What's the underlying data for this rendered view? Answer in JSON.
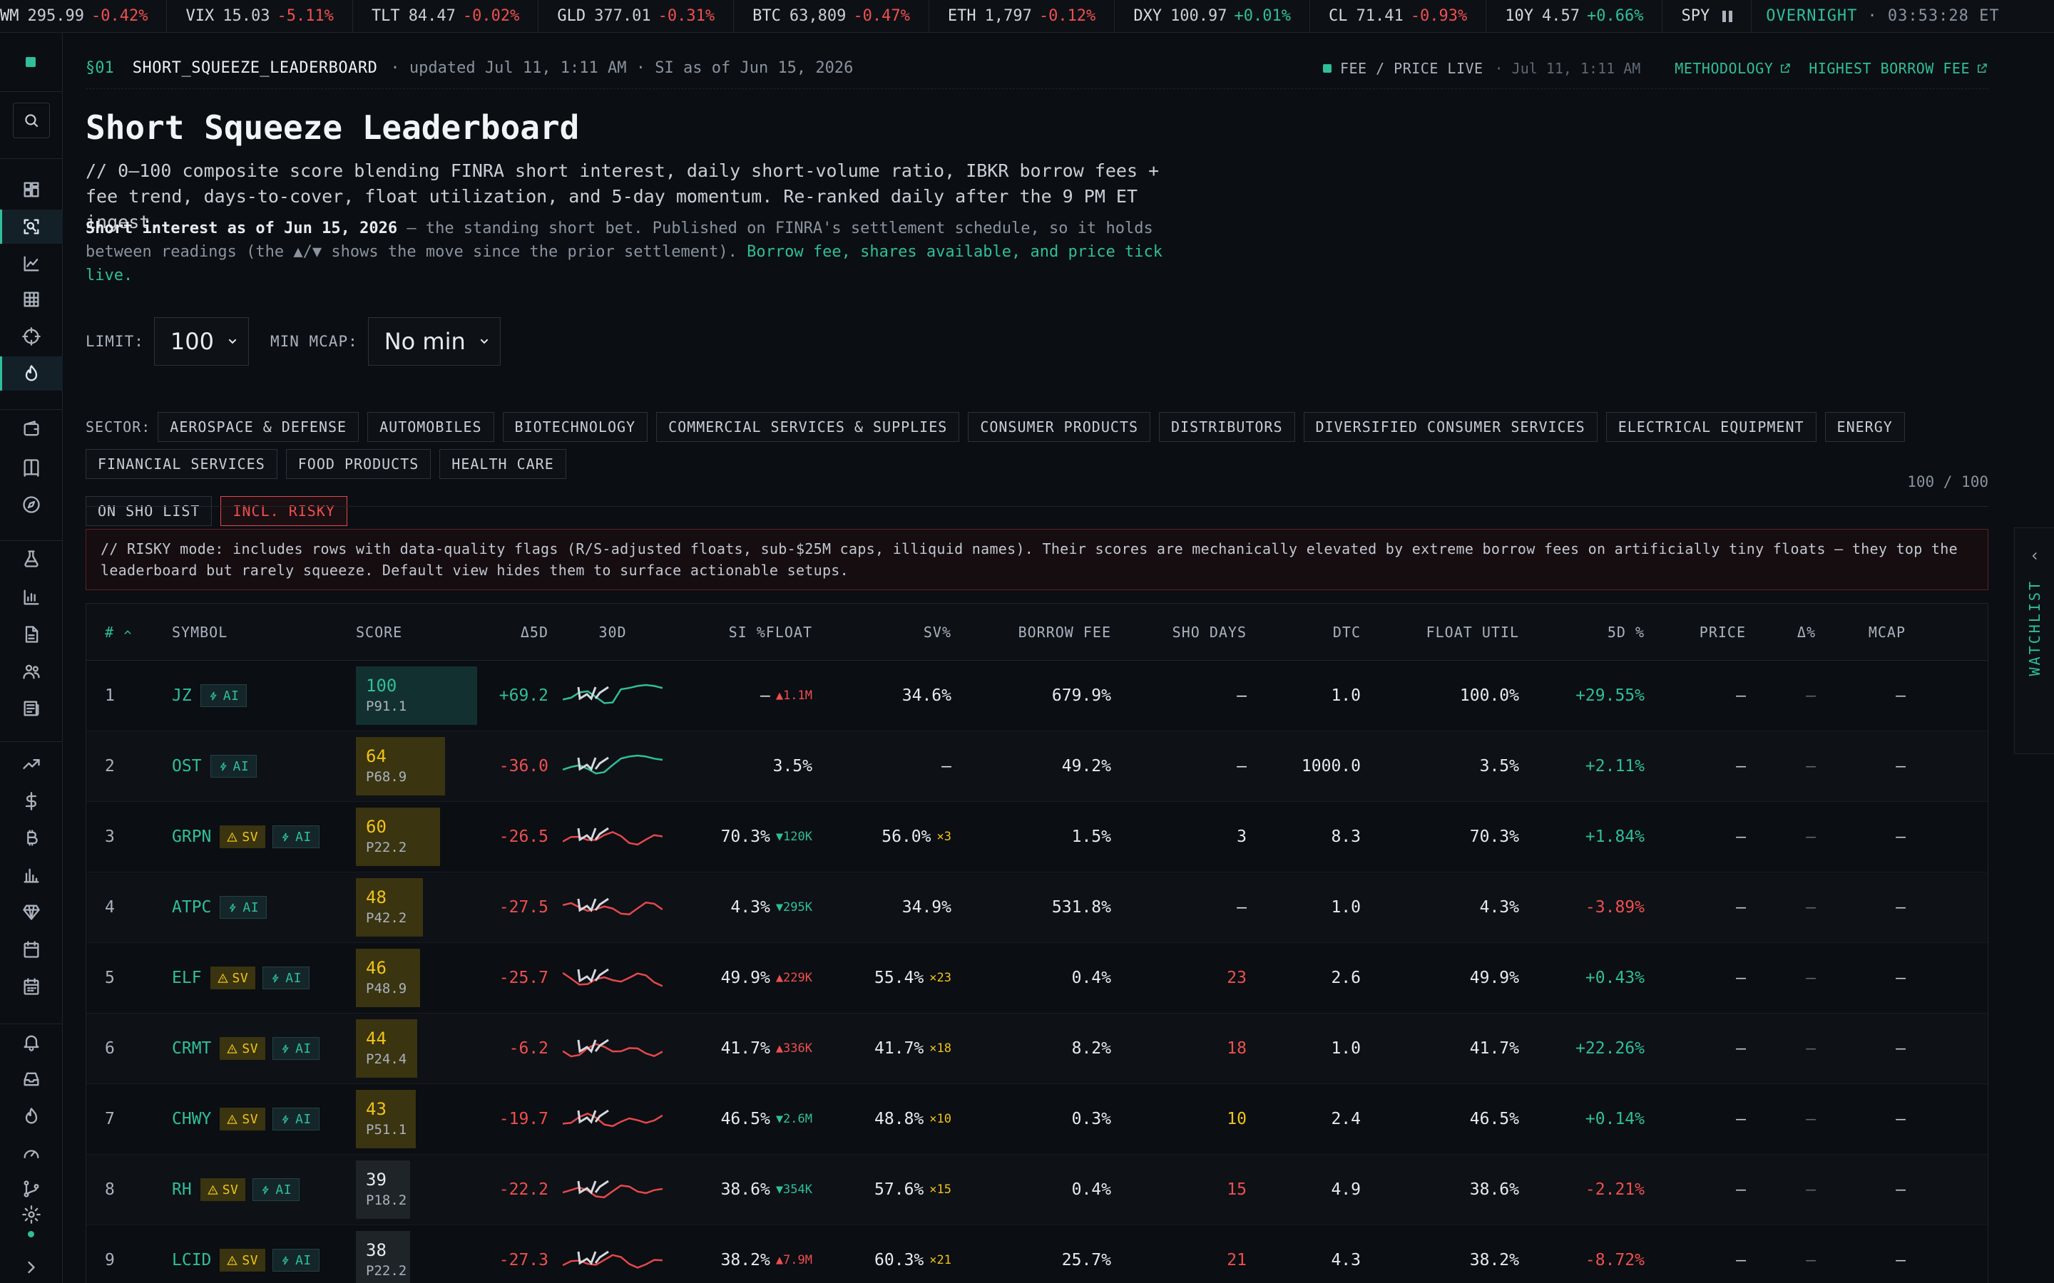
{
  "ticker": {
    "items": [
      {
        "sym": "WM",
        "price": "295.99",
        "chg": "-0.42%",
        "dir": "neg"
      },
      {
        "sym": "VIX",
        "price": "15.03",
        "chg": "-5.11%",
        "dir": "neg"
      },
      {
        "sym": "TLT",
        "price": "84.47",
        "chg": "-0.02%",
        "dir": "neg"
      },
      {
        "sym": "GLD",
        "price": "377.01",
        "chg": "-0.31%",
        "dir": "neg"
      },
      {
        "sym": "BTC",
        "price": "63,809",
        "chg": "-0.47%",
        "dir": "neg"
      },
      {
        "sym": "ETH",
        "price": "1,797",
        "chg": "-0.12%",
        "dir": "neg"
      },
      {
        "sym": "DXY",
        "price": "100.97",
        "chg": "+0.01%",
        "dir": "pos"
      },
      {
        "sym": "CL",
        "price": "71.41",
        "chg": "-0.93%",
        "dir": "neg"
      },
      {
        "sym": "10Y",
        "price": "4.57",
        "chg": "+0.66%",
        "dir": "pos"
      }
    ],
    "paused_sym": "SPY",
    "session": "OVERNIGHT",
    "clock": "· 03:53:28 ET"
  },
  "rail": {
    "icons": [
      "dashboard-icon",
      "screener-icon",
      "chart-line-icon",
      "grid-icon",
      "crosshair-icon",
      "flame-icon",
      "wallet-icon",
      "book-icon",
      "compass-icon",
      "flask-icon",
      "bar-chart-icon",
      "document-icon",
      "users-icon",
      "newspaper-icon",
      "trending-icon",
      "dollar-icon",
      "bitcoin-icon",
      "column-chart-icon",
      "gem-icon",
      "calendar-icon",
      "calendar-grid-icon",
      "bell-icon",
      "inbox-icon",
      "fire-icon",
      "gauge-icon",
      "git-branch-icon",
      "settings-icon"
    ]
  },
  "header": {
    "section": "§01",
    "key": "SHORT_SQUEEZE_LEADERBOARD",
    "meta": "· updated Jul 11, 1:11 AM · SI as of Jun 15, 2026",
    "live_label": "FEE / PRICE LIVE",
    "live_time": "· Jul 11, 1:11 AM",
    "methodology": "METHODOLOGY",
    "highest_fee": "HIGHEST BORROW FEE"
  },
  "page": {
    "title": "Short Squeeze Leaderboard",
    "lede": "// 0–100 composite score blending FINRA short interest, daily short-volume ratio, IBKR borrow fees + fee trend, days-to-cover, float utilization, and 5-day momentum. Re-ranked daily after the 9 PM ET ingest.",
    "asof_bold": "Short interest as of Jun 15, 2026",
    "asof_text": " — the standing short bet. Published on FINRA's settlement schedule, so it holds between readings (the ▲/▼ shows the move since the prior settlement). ",
    "asof_live": "Borrow fee, shares available, and price tick live."
  },
  "filters": {
    "limit_label": "LIMIT:",
    "limit_value": "100",
    "mcap_label": "MIN MCAP:",
    "mcap_value": "No min",
    "sector_label": "SECTOR:",
    "sectors": [
      "AEROSPACE & DEFENSE",
      "AUTOMOBILES",
      "BIOTECHNOLOGY",
      "COMMERCIAL SERVICES & SUPPLIES",
      "CONSUMER PRODUCTS",
      "DISTRIBUTORS",
      "DIVERSIFIED CONSUMER SERVICES",
      "ELECTRICAL EQUIPMENT",
      "ENERGY",
      "FINANCIAL SERVICES",
      "FOOD PRODUCTS",
      "HEALTH CARE"
    ],
    "sho_list": "ON SHO LIST",
    "risky": "INCL. RISKY",
    "count": "100 / 100"
  },
  "warning": "// RISKY mode: includes rows with data-quality flags (R/S-adjusted floats, sub-$25M caps, illiquid names). Their scores are mechanically elevated by extreme borrow fees on artificially tiny floats — they top the leaderboard but rarely squeeze. Default view hides them to surface actionable setups.",
  "table": {
    "columns": [
      "#",
      "SYMBOL",
      "SCORE",
      "Δ5D",
      "30D",
      "SI %FLOAT",
      "SV%",
      "BORROW FEE",
      "SHO DAYS",
      "DTC",
      "FLOAT UTIL",
      "5D %",
      "PRICE",
      "Δ%",
      "MCAP"
    ],
    "rows": [
      {
        "rank": "1",
        "sym": "JZ",
        "sv": false,
        "score": "100",
        "pctile": "P91.1",
        "tier": "teal",
        "d5": "+69.2",
        "d5dir": "pos",
        "trend": "up",
        "si": "—",
        "si_chg": "▲1.1M",
        "si_dir": "up",
        "sv_pct": "34.6%",
        "sv_mult": "",
        "fee": "679.9%",
        "sho": "—",
        "sho_tier": "none",
        "dtc": "1.0",
        "util": "100.0%",
        "r5d": "+29.55%",
        "r5d_dir": "pos",
        "price": "—",
        "dp": "—",
        "mcap": "—"
      },
      {
        "rank": "2",
        "sym": "OST",
        "sv": false,
        "score": "64",
        "pctile": "P68.9",
        "tier": "amber",
        "d5": "-36.0",
        "d5dir": "neg",
        "trend": "up",
        "si": "3.5%",
        "si_chg": "",
        "si_dir": "",
        "sv_pct": "—",
        "sv_mult": "",
        "fee": "49.2%",
        "sho": "—",
        "sho_tier": "none",
        "dtc": "1000.0",
        "util": "3.5%",
        "r5d": "+2.11%",
        "r5d_dir": "pos",
        "price": "—",
        "dp": "—",
        "mcap": "—"
      },
      {
        "rank": "3",
        "sym": "GRPN",
        "sv": true,
        "score": "60",
        "pctile": "P22.2",
        "tier": "amber",
        "d5": "-26.5",
        "d5dir": "neg",
        "trend": "down",
        "si": "70.3%",
        "si_chg": "▼120K",
        "si_dir": "down",
        "sv_pct": "56.0%",
        "sv_mult": "×3",
        "fee": "1.5%",
        "sho": "3",
        "sho_tier": "plain",
        "dtc": "8.3",
        "util": "70.3%",
        "r5d": "+1.84%",
        "r5d_dir": "pos",
        "price": "—",
        "dp": "—",
        "mcap": "—"
      },
      {
        "rank": "4",
        "sym": "ATPC",
        "sv": false,
        "score": "48",
        "pctile": "P42.2",
        "tier": "amber",
        "d5": "-27.5",
        "d5dir": "neg",
        "trend": "down",
        "si": "4.3%",
        "si_chg": "▼295K",
        "si_dir": "down",
        "sv_pct": "34.9%",
        "sv_mult": "",
        "fee": "531.8%",
        "sho": "—",
        "sho_tier": "none",
        "dtc": "1.0",
        "util": "4.3%",
        "r5d": "-3.89%",
        "r5d_dir": "neg",
        "price": "—",
        "dp": "—",
        "mcap": "—"
      },
      {
        "rank": "5",
        "sym": "ELF",
        "sv": true,
        "score": "46",
        "pctile": "P48.9",
        "tier": "amber",
        "d5": "-25.7",
        "d5dir": "neg",
        "trend": "down",
        "si": "49.9%",
        "si_chg": "▲229K",
        "si_dir": "up",
        "sv_pct": "55.4%",
        "sv_mult": "×23",
        "fee": "0.4%",
        "sho": "23",
        "sho_tier": "hot",
        "dtc": "2.6",
        "util": "49.9%",
        "r5d": "+0.43%",
        "r5d_dir": "pos",
        "price": "—",
        "dp": "—",
        "mcap": "—"
      },
      {
        "rank": "6",
        "sym": "CRMT",
        "sv": true,
        "score": "44",
        "pctile": "P24.4",
        "tier": "amber",
        "d5": "-6.2",
        "d5dir": "neg",
        "trend": "down",
        "si": "41.7%",
        "si_chg": "▲336K",
        "si_dir": "up",
        "sv_pct": "41.7%",
        "sv_mult": "×18",
        "fee": "8.2%",
        "sho": "18",
        "sho_tier": "hot",
        "dtc": "1.0",
        "util": "41.7%",
        "r5d": "+22.26%",
        "r5d_dir": "pos",
        "price": "—",
        "dp": "—",
        "mcap": "—"
      },
      {
        "rank": "7",
        "sym": "CHWY",
        "sv": true,
        "score": "43",
        "pctile": "P51.1",
        "tier": "amber",
        "d5": "-19.7",
        "d5dir": "neg",
        "trend": "down",
        "si": "46.5%",
        "si_chg": "▼2.6M",
        "si_dir": "down",
        "sv_pct": "48.8%",
        "sv_mult": "×10",
        "fee": "0.3%",
        "sho": "10",
        "sho_tier": "warm",
        "dtc": "2.4",
        "util": "46.5%",
        "r5d": "+0.14%",
        "r5d_dir": "pos",
        "price": "—",
        "dp": "—",
        "mcap": "—"
      },
      {
        "rank": "8",
        "sym": "RH",
        "sv": true,
        "score": "39",
        "pctile": "P18.2",
        "tier": "gray",
        "d5": "-22.2",
        "d5dir": "neg",
        "trend": "down",
        "si": "38.6%",
        "si_chg": "▼354K",
        "si_dir": "down",
        "sv_pct": "57.6%",
        "sv_mult": "×15",
        "fee": "0.4%",
        "sho": "15",
        "sho_tier": "hot",
        "dtc": "4.9",
        "util": "38.6%",
        "r5d": "-2.21%",
        "r5d_dir": "neg",
        "price": "—",
        "dp": "—",
        "mcap": "—"
      },
      {
        "rank": "9",
        "sym": "LCID",
        "sv": true,
        "score": "38",
        "pctile": "P22.2",
        "tier": "gray",
        "d5": "-27.3",
        "d5dir": "neg",
        "trend": "down",
        "si": "38.2%",
        "si_chg": "▲7.9M",
        "si_dir": "up",
        "sv_pct": "60.3%",
        "sv_mult": "×21",
        "fee": "25.7%",
        "sho": "21",
        "sho_tier": "hot",
        "dtc": "4.3",
        "util": "38.2%",
        "r5d": "-8.72%",
        "r5d_dir": "neg",
        "price": "—",
        "dp": "—",
        "mcap": "—"
      }
    ]
  },
  "badges": {
    "sv": "SV",
    "ai": "AI"
  },
  "watchlist": "WATCHLIST",
  "colors": {
    "accent": "#2fbf9a",
    "negative": "#ef4f4f",
    "warning": "#f0c419",
    "background": "#0b0e12"
  }
}
